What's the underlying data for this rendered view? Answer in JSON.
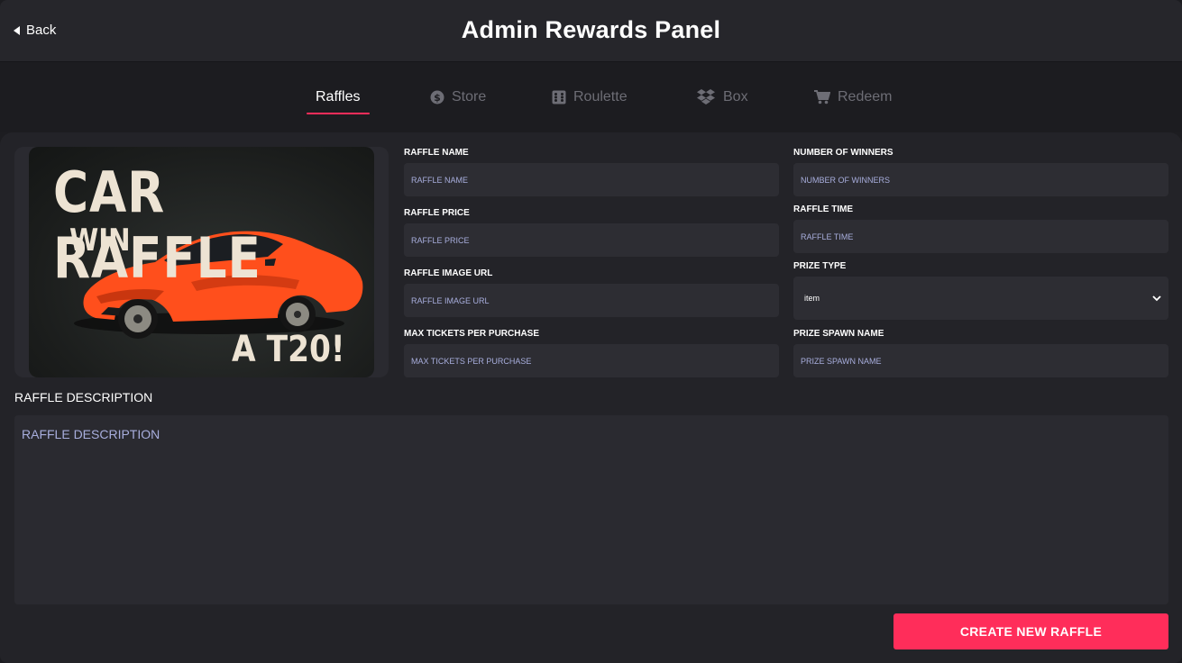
{
  "header": {
    "back_label": "Back",
    "title": "Admin Rewards Panel"
  },
  "tabs": [
    {
      "label": "Raffles",
      "icon": "none",
      "active": true
    },
    {
      "label": "Store",
      "icon": "dollar-coin-icon",
      "active": false
    },
    {
      "label": "Roulette",
      "icon": "dice-icon",
      "active": false
    },
    {
      "label": "Box",
      "icon": "dropbox-icon",
      "active": false
    },
    {
      "label": "Redeem",
      "icon": "cart-icon",
      "active": false
    }
  ],
  "poster": {
    "line1": "CAR RAFFLE",
    "line2": "WIN",
    "line3": "A T20!"
  },
  "form": {
    "raffle_name": {
      "label": "RAFFLE NAME",
      "placeholder": "RAFFLE NAME",
      "value": ""
    },
    "raffle_price": {
      "label": "RAFFLE PRICE",
      "placeholder": "RAFFLE PRICE",
      "value": ""
    },
    "raffle_image_url": {
      "label": "RAFFLE IMAGE URL",
      "placeholder": "RAFFLE IMAGE URL",
      "value": ""
    },
    "max_tickets": {
      "label": "MAX TICKETS PER PURCHASE",
      "placeholder": "MAX TICKETS PER PURCHASE",
      "value": ""
    },
    "number_of_winners": {
      "label": "NUMBER OF WINNERS",
      "placeholder": "NUMBER OF WINNERS",
      "value": ""
    },
    "raffle_time": {
      "label": "RAFFLE TIME",
      "placeholder": "RAFFLE TIME",
      "value": ""
    },
    "prize_type": {
      "label": "PRIZE TYPE",
      "selected": "item"
    },
    "prize_spawn_name": {
      "label": "PRIZE SPAWN NAME",
      "placeholder": "PRIZE SPAWN NAME",
      "value": ""
    },
    "description": {
      "label": "RAFFLE DESCRIPTION",
      "placeholder": "RAFFLE DESCRIPTION",
      "value": ""
    }
  },
  "actions": {
    "create_label": "CREATE NEW RAFFLE"
  },
  "colors": {
    "accent": "#ff2d5a",
    "background": "#1d1d21",
    "panel": "#232328",
    "input": "#2d2d33",
    "placeholder": "#a8aedd"
  }
}
